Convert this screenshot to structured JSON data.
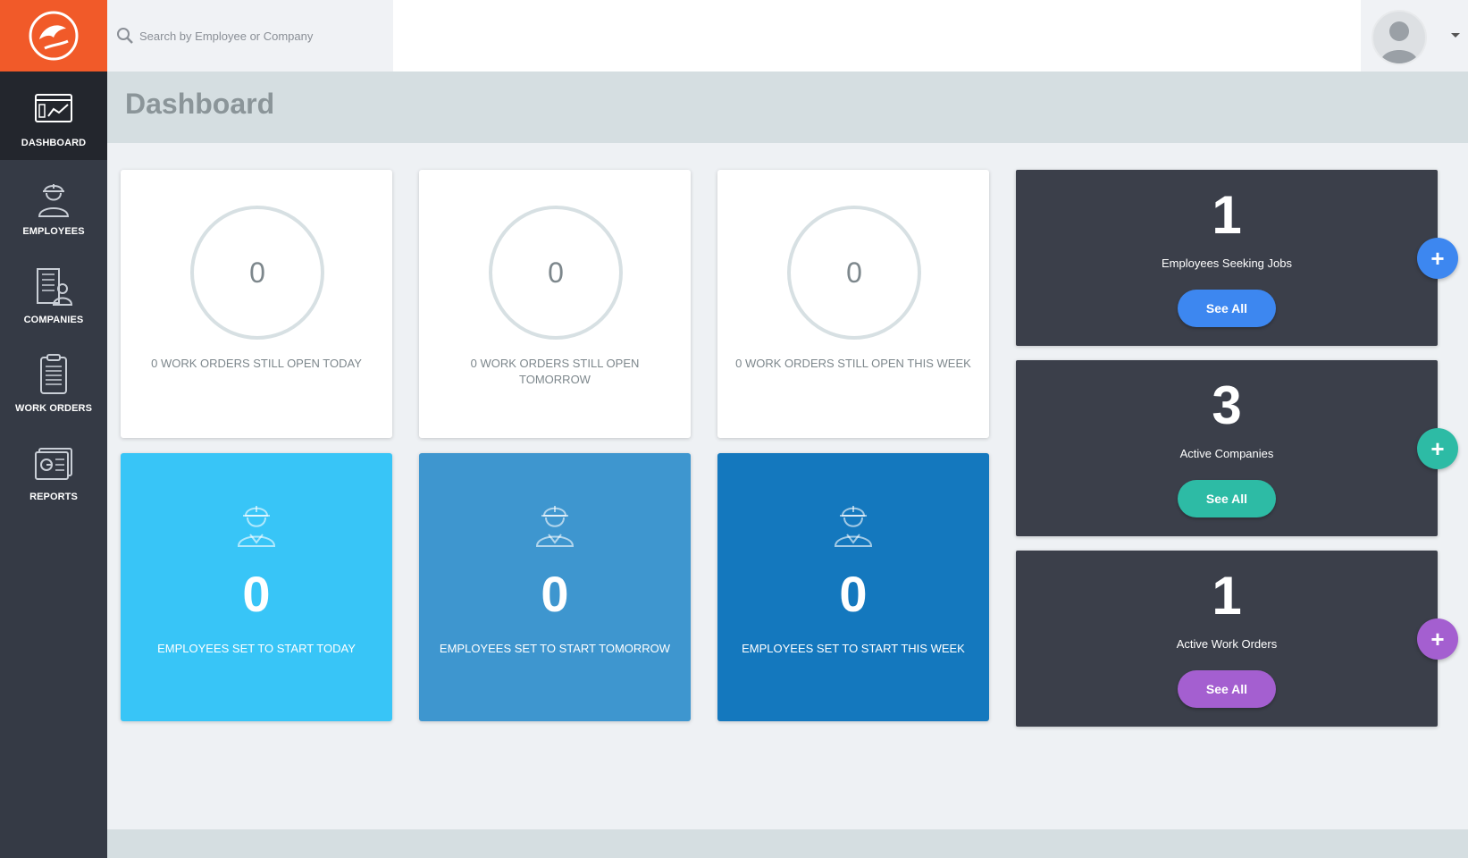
{
  "search": {
    "placeholder": "Search by Employee or Company"
  },
  "sidebar": {
    "items": [
      {
        "label": "DASHBOARD",
        "icon": "dashboard-icon"
      },
      {
        "label": "EMPLOYEES",
        "icon": "worker-icon"
      },
      {
        "label": "COMPANIES",
        "icon": "building-icon"
      },
      {
        "label": "WORK ORDERS",
        "icon": "document-icon"
      },
      {
        "label": "REPORTS",
        "icon": "report-icon"
      }
    ]
  },
  "header": {
    "title": "Dashboard"
  },
  "work_orders": [
    {
      "value": "0",
      "caption": "0 WORK ORDERS STILL OPEN TODAY"
    },
    {
      "value": "0",
      "caption": "0 WORK ORDERS STILL OPEN TOMORROW"
    },
    {
      "value": "0",
      "caption": "0 WORK ORDERS STILL OPEN THIS WEEK"
    }
  ],
  "employees_start": [
    {
      "value": "0",
      "caption": "EMPLOYEES SET TO START TODAY",
      "color": "#38c5f7"
    },
    {
      "value": "0",
      "caption": "EMPLOYEES SET TO START TOMORROW",
      "color": "#3e96cf"
    },
    {
      "value": "0",
      "caption": "EMPLOYEES SET TO START THIS WEEK",
      "color": "#1478be"
    }
  ],
  "stats": [
    {
      "value": "1",
      "label": "Employees Seeking Jobs",
      "button": "See All",
      "color": "#3d87f0"
    },
    {
      "value": "3",
      "label": "Active Companies",
      "button": "See All",
      "color": "#2dbba5"
    },
    {
      "value": "1",
      "label": "Active Work Orders",
      "button": "See All",
      "color": "#a45fd0"
    }
  ],
  "colors": {
    "brand": "#f15a29",
    "sidebar": "#353a45",
    "panel": "#3b3f4a"
  }
}
